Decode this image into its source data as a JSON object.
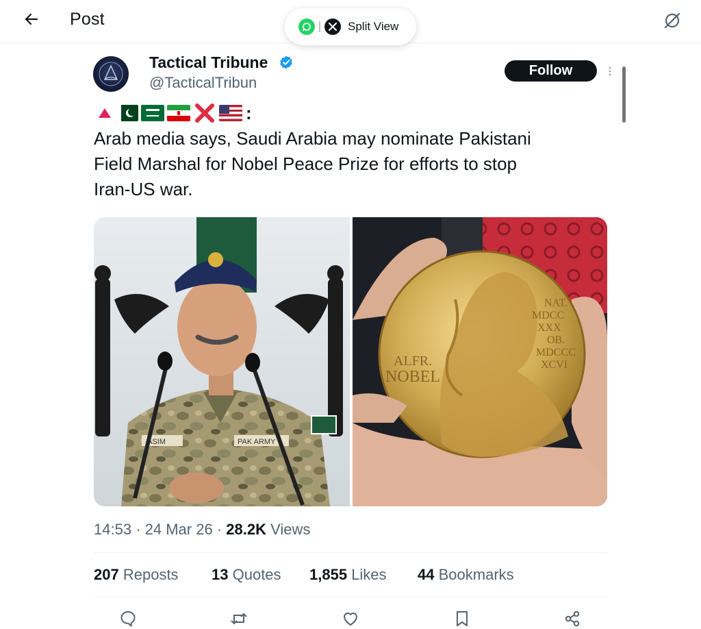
{
  "header": {
    "title": "Post"
  },
  "split_view": {
    "label": "Split View"
  },
  "author": {
    "name": "Tactical Tribune",
    "handle": "@TacticalTribun"
  },
  "follow": {
    "label": "Follow"
  },
  "post": {
    "flags_suffix": ":",
    "text": "Arab media says, Saudi Arabia may nominate Pakistani\nField Marshal for Nobel Peace Prize for efforts to stop\nIran-US war.",
    "images": [
      {
        "label_left": "ASIM",
        "label_right": "PAK ARMY"
      },
      {
        "medal_text": "ALFR.\nNOBEL",
        "medal_roman": "NAT.\nMDCC\nXXX\nOB.\nMDCCC\nXCVI"
      }
    ]
  },
  "meta": {
    "time": "14:53",
    "date": "24 Mar 26",
    "views_count": "28.2K",
    "views_label": "Views"
  },
  "stats": {
    "reposts_count": "207",
    "reposts_label": "Reposts",
    "quotes_count": "13",
    "quotes_label": "Quotes",
    "likes_count": "1,855",
    "likes_label": "Likes",
    "bookmarks_count": "44",
    "bookmarks_label": "Bookmarks"
  },
  "colors": {
    "text": "#0f1419",
    "muted": "#536471",
    "verified": "#1d9bf0",
    "divider": "#eff3f4"
  },
  "icons": [
    "back-arrow-icon",
    "grok-icon",
    "whatsapp-icon",
    "x-logo-icon",
    "verified-badge-icon",
    "more-icon",
    "reply-icon",
    "repost-icon",
    "like-icon",
    "bookmark-icon",
    "share-icon"
  ]
}
